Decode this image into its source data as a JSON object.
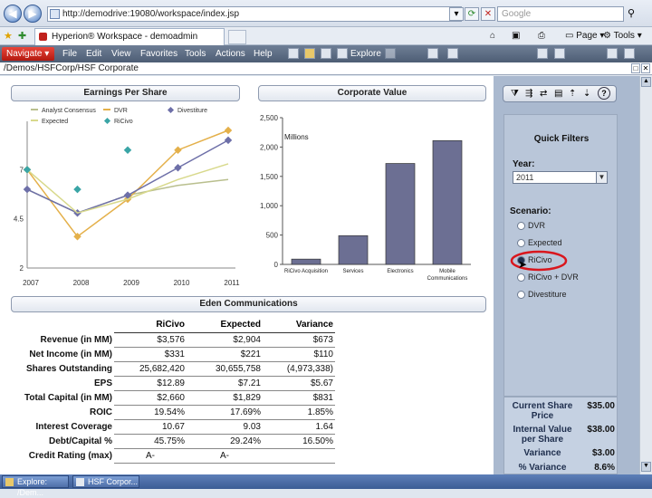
{
  "browser": {
    "url": "http://demodrive:19080/workspace/index.jsp",
    "search_placeholder": "Google",
    "tab_title": "Hyperion® Workspace - demoadmin",
    "page_label": "Page",
    "tools_label": "Tools"
  },
  "app": {
    "navigate_label": "Navigate",
    "menus": [
      "File",
      "Edit",
      "View",
      "Favorites",
      "Tools",
      "Actions",
      "Help"
    ],
    "explore_label": "Explore",
    "path": "/Demos/HSFCorp/HSF Corporate"
  },
  "eps_chart": {
    "title": "Earnings Per Share",
    "legend": [
      "Analyst Consensus",
      "DVR",
      "Divestiture",
      "Expected",
      "RiCivo"
    ],
    "chart_data": {
      "type": "line",
      "x": [
        "2007",
        "2008",
        "2009",
        "2010",
        "2011"
      ],
      "yticks": [
        "2",
        "4.5",
        "7"
      ],
      "ylim": [
        2,
        9
      ],
      "series": [
        {
          "name": "Analyst Consensus",
          "values": [
            6.0,
            4.8,
            5.7,
            6.2,
            6.5
          ]
        },
        {
          "name": "DVR",
          "values": [
            7.0,
            3.6,
            5.5,
            8.0,
            9.0
          ]
        },
        {
          "name": "Divestiture",
          "values": [
            6.0,
            4.8,
            5.7,
            7.1,
            8.5
          ]
        },
        {
          "name": "Expected",
          "values": [
            7.0,
            4.8,
            5.5,
            6.5,
            7.3
          ]
        },
        {
          "name": "RiCivo",
          "values": [
            7.0,
            6.0,
            8.0,
            null,
            null
          ]
        }
      ]
    }
  },
  "cv_chart": {
    "title": "Corporate Value",
    "unit_label": "Millions",
    "chart_data": {
      "type": "bar",
      "categories": [
        "RiCivo Acquisition",
        "Services",
        "Electronics",
        "Mobile Communications"
      ],
      "values": [
        90,
        490,
        1720,
        2110
      ],
      "ylim": [
        0,
        2500
      ],
      "yticks": [
        "0",
        "500",
        "1,000",
        "1,500",
        "2,000",
        "2,500"
      ]
    }
  },
  "eden": {
    "title": "Eden Communications",
    "columns": [
      "RiCivo",
      "Expected",
      "Variance"
    ],
    "rows": [
      {
        "label": "Revenue (in MM)",
        "values": [
          "$3,576",
          "$2,904",
          "$673"
        ]
      },
      {
        "label": "Net Income (in MM)",
        "values": [
          "$331",
          "$221",
          "$110"
        ]
      },
      {
        "label": "Shares Outstanding",
        "values": [
          "25,682,420",
          "30,655,758",
          "(4,973,338)"
        ]
      },
      {
        "label": "EPS",
        "values": [
          "$12.89",
          "$7.21",
          "$5.67"
        ]
      },
      {
        "label": "Total Capital (in MM)",
        "values": [
          "$2,660",
          "$1,829",
          "$831"
        ]
      },
      {
        "label": "ROIC",
        "values": [
          "19.54%",
          "17.69%",
          "1.85%"
        ]
      },
      {
        "label": "Interest Coverage",
        "values": [
          "10.67",
          "9.03",
          "1.64"
        ]
      },
      {
        "label": "Debt/Capital %",
        "values": [
          "45.75%",
          "29.24%",
          "16.50%"
        ]
      },
      {
        "label": "Credit Rating (max)",
        "values": [
          "A-",
          "A-",
          ""
        ]
      }
    ]
  },
  "quick_filters": {
    "title": "Quick Filters",
    "year_label": "Year:",
    "year_value": "2011",
    "scenario_label": "Scenario:",
    "scenarios": [
      "DVR",
      "Expected",
      "RiCivo",
      "RiCivo + DVR",
      "Divestiture"
    ],
    "selected_scenario": "RiCivo",
    "highlight_color": "#d9161d"
  },
  "price_box": {
    "items": [
      {
        "label": "Current Share Price",
        "value": "$35.00"
      },
      {
        "label": "Internal Value per Share",
        "value": "$38.00"
      },
      {
        "label": "Variance",
        "value": "$3.00"
      },
      {
        "label": "% Variance",
        "value": "8.6%"
      }
    ]
  },
  "taskbar": {
    "items": [
      "Explore: /Dem...",
      "HSF Corpor..."
    ]
  }
}
